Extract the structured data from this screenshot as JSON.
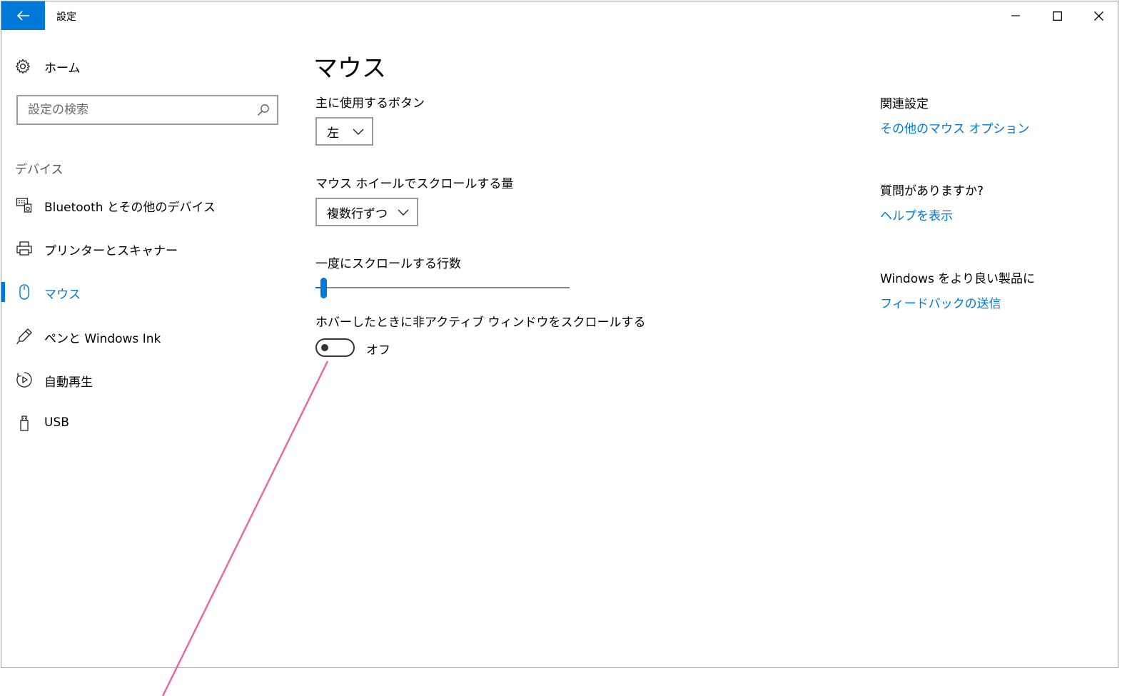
{
  "window": {
    "title": "設定",
    "icons": {
      "back": "arrow-left-icon",
      "minimize": "minimize-icon",
      "maximize": "maximize-icon",
      "close": "close-icon"
    }
  },
  "sidebar": {
    "home_label": "ホーム",
    "search_placeholder": "設定の検索",
    "section_label": "デバイス",
    "items": [
      {
        "label": "Bluetooth とその他のデバイス",
        "icon": "bluetooth-devices-icon"
      },
      {
        "label": "プリンターとスキャナー",
        "icon": "printer-icon"
      },
      {
        "label": "マウス",
        "icon": "mouse-icon",
        "active": true
      },
      {
        "label": "ペンと Windows Ink",
        "icon": "pen-icon"
      },
      {
        "label": "自動再生",
        "icon": "autoplay-icon"
      },
      {
        "label": "USB",
        "icon": "usb-icon"
      }
    ]
  },
  "main": {
    "title": "マウス",
    "primary_button": {
      "label": "主に使用するボタン",
      "value": "左"
    },
    "wheel_scroll": {
      "label": "マウス ホイールでスクロールする量",
      "value": "複数行ずつ"
    },
    "lines_to_scroll": {
      "label": "一度にスクロールする行数",
      "value_fraction": 0.03
    },
    "inactive_scroll": {
      "label": "ホバーしたときに非アクティブ ウィンドウをスクロールする",
      "state": "オフ",
      "on": false
    }
  },
  "related": {
    "heading": "関連設定",
    "link": "その他のマウス オプション",
    "question_heading": "質問がありますか?",
    "help_link": "ヘルプを表示",
    "feedback_heading": "Windows をより良い製品に",
    "feedback_link": "フィードバックの送信"
  },
  "colors": {
    "accent": "#0078d7",
    "annotation": "#e46aa6"
  }
}
